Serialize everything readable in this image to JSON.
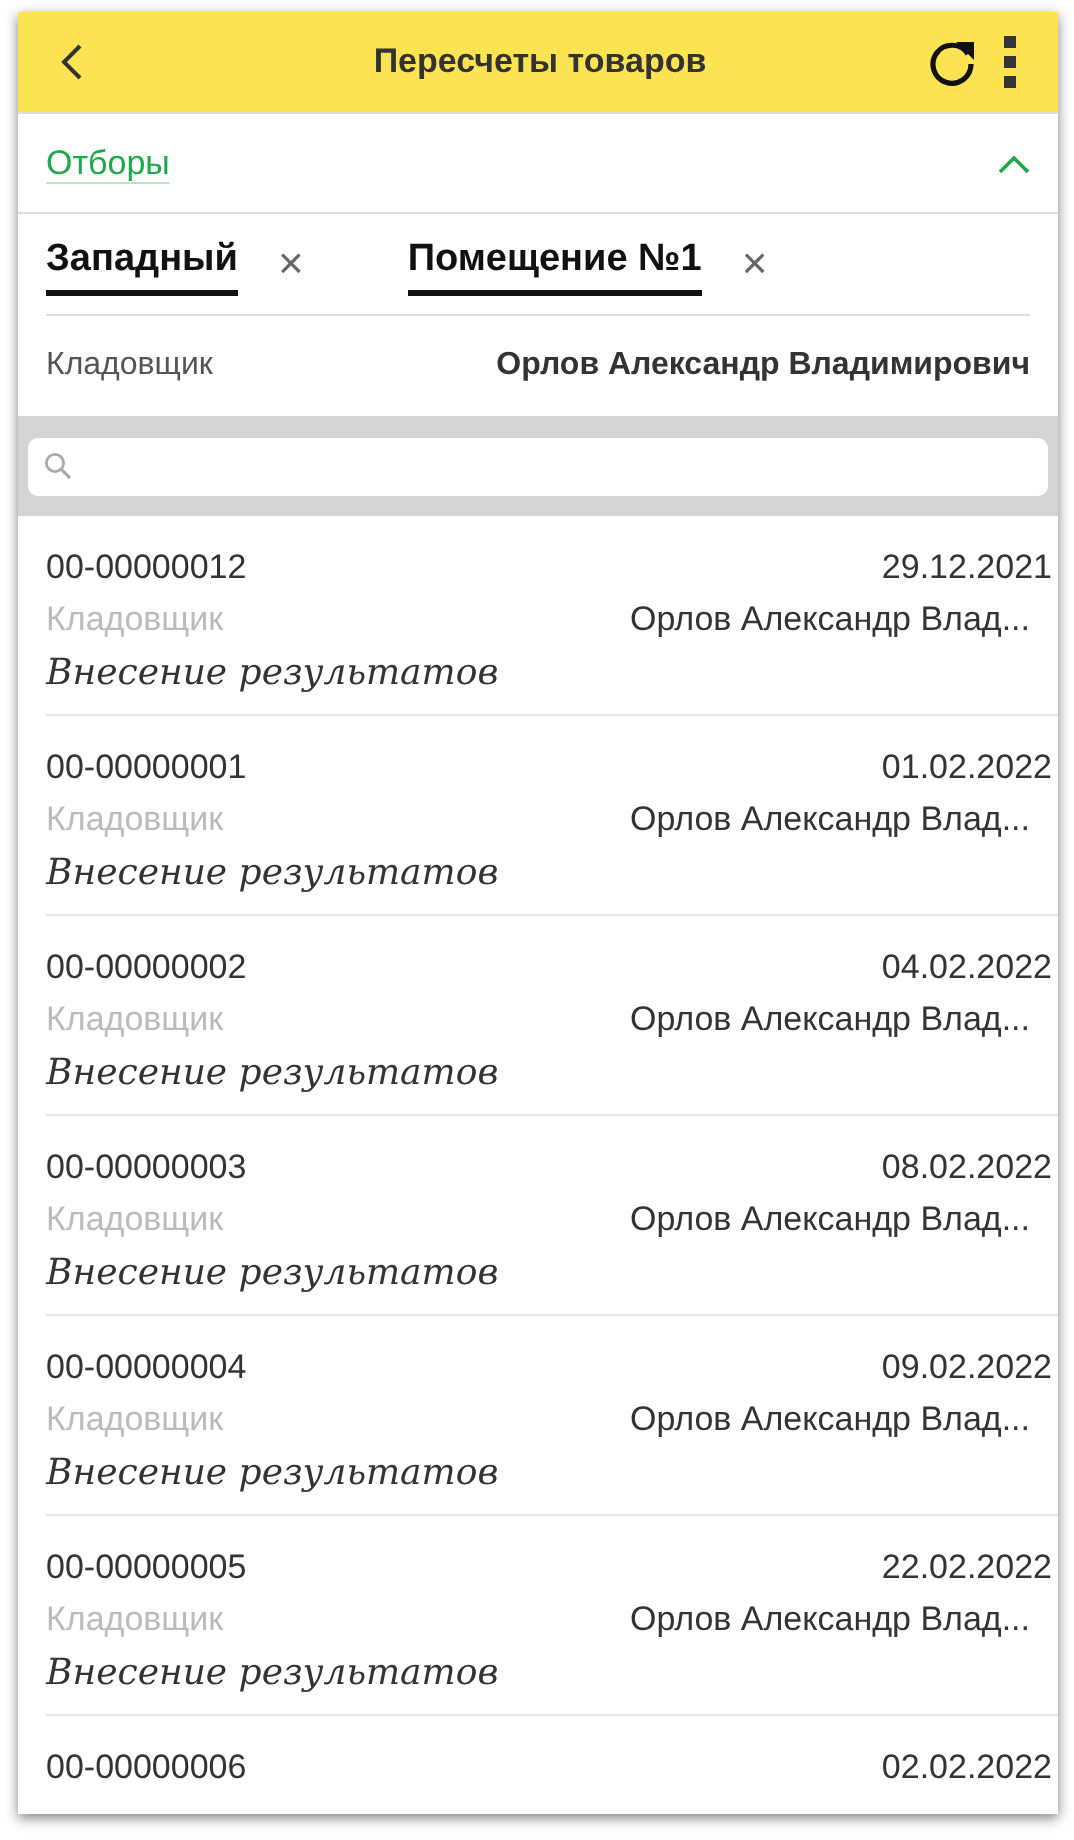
{
  "header": {
    "title": "Пересчеты товаров"
  },
  "filters": {
    "label": "Отборы",
    "expanded": true,
    "chips": [
      {
        "label": "Западный",
        "remove": "×"
      },
      {
        "label": "Помещение №1",
        "remove": "×"
      }
    ],
    "field": {
      "label": "Кладовщик",
      "value": "Орлов Александр Владимирович"
    }
  },
  "rows": [
    {
      "number": "00-00000012",
      "date": "29.12.2021",
      "label": "Кладовщик",
      "person": "Орлов Александр Влад...",
      "status": "Внесение результатов"
    },
    {
      "number": "00-00000001",
      "date": "01.02.2022",
      "label": "Кладовщик",
      "person": "Орлов Александр Влад...",
      "status": "Внесение результатов"
    },
    {
      "number": "00-00000002",
      "date": "04.02.2022",
      "label": "Кладовщик",
      "person": "Орлов Александр Влад...",
      "status": "Внесение результатов"
    },
    {
      "number": "00-00000003",
      "date": "08.02.2022",
      "label": "Кладовщик",
      "person": "Орлов Александр Влад...",
      "status": "Внесение результатов"
    },
    {
      "number": "00-00000004",
      "date": "09.02.2022",
      "label": "Кладовщик",
      "person": "Орлов Александр Влад...",
      "status": "Внесение результатов"
    },
    {
      "number": "00-00000005",
      "date": "22.02.2022",
      "label": "Кладовщик",
      "person": "Орлов Александр Влад...",
      "status": "Внесение результатов"
    },
    {
      "number": "00-00000006",
      "date": "02.02.2022"
    }
  ]
}
